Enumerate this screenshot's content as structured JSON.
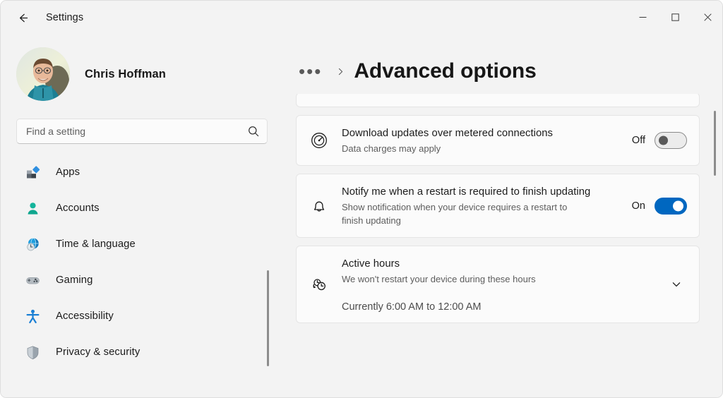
{
  "window": {
    "titlebar_label": "Settings",
    "back_icon": "back-arrow-icon",
    "minimize_label": "─",
    "maximize_label": "□",
    "close_label": "✕"
  },
  "sidebar": {
    "profile": {
      "name": "Chris Hoffman",
      "avatar": "user-avatar-photo"
    },
    "search": {
      "placeholder": "Find a setting",
      "value": "",
      "icon": "search-icon"
    },
    "items": [
      {
        "label": "Apps",
        "icon": "apps-icon"
      },
      {
        "label": "Accounts",
        "icon": "accounts-icon"
      },
      {
        "label": "Time & language",
        "icon": "time-language-icon"
      },
      {
        "label": "Gaming",
        "icon": "gaming-icon"
      },
      {
        "label": "Accessibility",
        "icon": "accessibility-icon"
      },
      {
        "label": "Privacy & security",
        "icon": "privacy-security-icon"
      }
    ]
  },
  "main": {
    "breadcrumb": {
      "overflow": "•••",
      "separator": "chevron-right-icon",
      "title": "Advanced options"
    },
    "cards": [
      {
        "id": "metered-connections",
        "icon": "speedometer-icon",
        "title": "Download updates over metered connections",
        "desc": "Data charges may apply",
        "toggle_label": "Off",
        "toggle_state": "off"
      },
      {
        "id": "restart-notification",
        "icon": "bell-icon",
        "title": "Notify me when a restart is required to finish updating",
        "desc": "Show notification when your device requires a restart to finish updating",
        "toggle_label": "On",
        "toggle_state": "on"
      },
      {
        "id": "active-hours",
        "icon": "active-hours-clock-icon",
        "title": "Active hours",
        "desc": "We won't restart your device during these hours",
        "extra": "Currently 6:00 AM to 12:00 AM",
        "expand_icon": "chevron-down-icon"
      }
    ]
  },
  "colors": {
    "accent": "#0067c0",
    "window_background": "#f3f3f3",
    "card_background": "#fbfbfb",
    "text_primary": "#1b1b1b",
    "text_secondary": "#5d5d5d"
  }
}
